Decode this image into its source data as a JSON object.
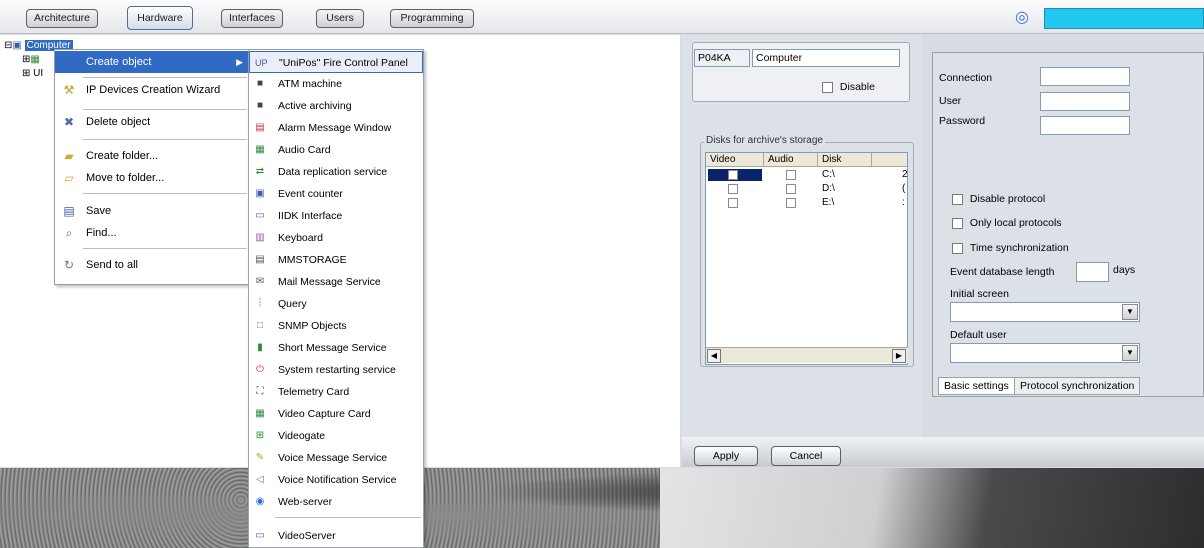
{
  "top_tabs": [
    {
      "label": "Architecture",
      "active": false
    },
    {
      "label": "Hardware",
      "active": true
    },
    {
      "label": "Interfaces",
      "active": false
    },
    {
      "label": "Users",
      "active": false
    },
    {
      "label": "Programming",
      "active": false
    }
  ],
  "tree": {
    "root": "Computer",
    "child1": "",
    "child2": "UI"
  },
  "context_menu": {
    "items": [
      {
        "label": "Create object",
        "icon": "create-object-icon",
        "highlighted": true,
        "submenu": true
      },
      {
        "label": "IP Devices Creation Wizard",
        "icon": "wizard-icon"
      },
      {
        "label": "Delete object",
        "icon": "delete-icon"
      },
      {
        "label": "Create folder...",
        "icon": "new-folder-icon"
      },
      {
        "label": "Move to folder...",
        "icon": "move-folder-icon"
      },
      {
        "label": "Save",
        "icon": "save-icon"
      },
      {
        "label": "Find...",
        "icon": "find-icon"
      },
      {
        "label": "Send to all",
        "icon": "send-all-icon"
      }
    ]
  },
  "submenu": {
    "items": [
      {
        "label": "\"UniPos\" Fire Control Panel",
        "icon": "unipos-icon",
        "glyph": "UP"
      },
      {
        "label": "ATM machine",
        "icon": "atm-icon",
        "glyph": "■"
      },
      {
        "label": "Active archiving",
        "icon": "archive-icon",
        "glyph": "■"
      },
      {
        "label": "Alarm Message Window",
        "icon": "alarm-window-icon",
        "glyph": "▤"
      },
      {
        "label": "Audio Card",
        "icon": "audio-card-icon",
        "glyph": "▦"
      },
      {
        "label": "Data replication service",
        "icon": "replication-icon",
        "glyph": "⇄"
      },
      {
        "label": "Event counter",
        "icon": "event-counter-icon",
        "glyph": "▣"
      },
      {
        "label": "IIDK Interface",
        "icon": "iidk-icon",
        "glyph": "▭"
      },
      {
        "label": "Keyboard",
        "icon": "keyboard-icon",
        "glyph": "▥"
      },
      {
        "label": "MMSTORAGE",
        "icon": "storage-icon",
        "glyph": "▤"
      },
      {
        "label": "Mail Message Service",
        "icon": "mail-icon",
        "glyph": "▭"
      },
      {
        "label": "Query",
        "icon": "query-icon",
        "glyph": "⫶"
      },
      {
        "label": "SNMP Objects",
        "icon": "snmp-icon",
        "glyph": "□"
      },
      {
        "label": "Short Message Service",
        "icon": "sms-icon",
        "glyph": "▮"
      },
      {
        "label": "System restarting service",
        "icon": "restart-icon",
        "glyph": "⏻"
      },
      {
        "label": "Telemetry Card",
        "icon": "telemetry-icon",
        "glyph": "⛶"
      },
      {
        "label": "Video Capture Card",
        "icon": "video-card-icon",
        "glyph": "▦"
      },
      {
        "label": "Videogate",
        "icon": "videogate-icon",
        "glyph": "⊞"
      },
      {
        "label": "Voice Message Service",
        "icon": "voice-message-icon",
        "glyph": "✎"
      },
      {
        "label": "Voice Notification Service",
        "icon": "voice-notify-icon",
        "glyph": "◁"
      },
      {
        "label": "Web-server",
        "icon": "web-server-icon",
        "glyph": "◉"
      },
      {
        "label": "VideoServer",
        "icon": "videoserver-icon",
        "glyph": "▭"
      }
    ]
  },
  "object": {
    "id": "P04KA",
    "name": "Computer",
    "disable_label": "Disable"
  },
  "disks": {
    "legend": "Disks for archive's storage",
    "columns": [
      "Video",
      "Audio",
      "Disk",
      ""
    ],
    "rows": [
      {
        "disk": "C:\\",
        "extra": "2"
      },
      {
        "disk": "D:\\",
        "extra": "("
      },
      {
        "disk": "E:\\",
        "extra": ":"
      }
    ]
  },
  "buttons": {
    "apply": "Apply",
    "cancel": "Cancel"
  },
  "settings": {
    "connection": "Connection",
    "user": "User",
    "password": "Password",
    "disable_protocol": "Disable protocol",
    "only_local": "Only local protocols",
    "time_sync": "Time synchronization",
    "event_db": "Event database length",
    "days": "days",
    "initial_screen": "Initial screen",
    "default_user": "Default user",
    "tab_basic": "Basic settings",
    "tab_protocol": "Protocol synchronization"
  },
  "colors": {
    "accent": "#316ac5",
    "cyan": "#21c7ef",
    "panel": "#dce1e8"
  }
}
